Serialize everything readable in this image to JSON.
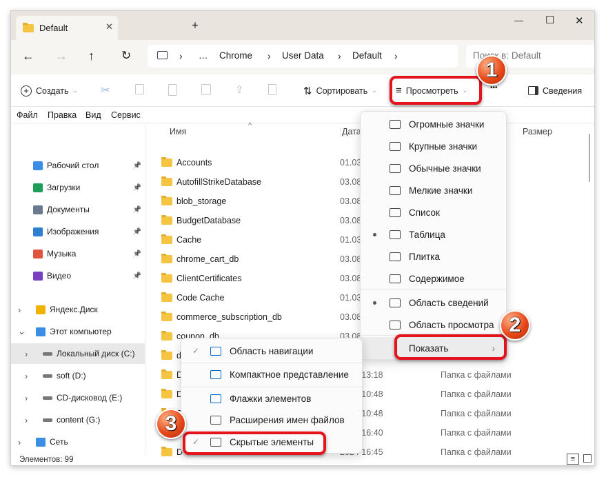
{
  "window": {
    "tab_title": "Default",
    "new_tab": "+",
    "controls": {
      "minimize": "—",
      "maximize": "☐",
      "close": "✕"
    }
  },
  "nav": {
    "breadcrumb": [
      "…",
      "Chrome",
      "User Data",
      "Default"
    ],
    "search_placeholder": "Поиск в: Default"
  },
  "toolbar": {
    "create": "Создать",
    "sort": "Сортировать",
    "view": "Просмотреть",
    "more": "•••",
    "details": "Сведения"
  },
  "menubar": [
    "Файл",
    "Правка",
    "Вид",
    "Сервис"
  ],
  "sidebar": {
    "quick": [
      {
        "label": "Рабочий стол",
        "color": "#3a8ee6"
      },
      {
        "label": "Загрузки",
        "color": "#1f9e5a"
      },
      {
        "label": "Документы",
        "color": "#6b7a8f"
      },
      {
        "label": "Изображения",
        "color": "#2f7fd0"
      },
      {
        "label": "Музыка",
        "color": "#e0533d"
      },
      {
        "label": "Видео",
        "color": "#7a3fc0"
      }
    ],
    "tree": [
      {
        "label": "Яндекс.Диск",
        "color": "#f0b400"
      },
      {
        "label": "Этот компьютер",
        "color": "#3a8ee6"
      },
      {
        "label": "Локальный диск (C:)",
        "color": "#777"
      },
      {
        "label": "soft (D:)",
        "color": "#777"
      },
      {
        "label": "CD-дисковод (E:)",
        "color": "#777"
      },
      {
        "label": "content (G:)",
        "color": "#777"
      },
      {
        "label": "Сеть",
        "color": "#3a8ee6"
      }
    ]
  },
  "columns": {
    "name": "Имя",
    "date": "Дата и",
    "size": "Размер"
  },
  "files": [
    {
      "name": "Accounts",
      "date": "01.03."
    },
    {
      "name": "AutofillStrikeDatabase",
      "date": "03.08."
    },
    {
      "name": "blob_storage",
      "date": "03.08."
    },
    {
      "name": "BudgetDatabase",
      "date": "03.08."
    },
    {
      "name": "Cache",
      "date": "01.03."
    },
    {
      "name": "chrome_cart_db",
      "date": "03.08."
    },
    {
      "name": "ClientCertificates",
      "date": "03.08."
    },
    {
      "name": "Code Cache",
      "date": "01.03."
    },
    {
      "name": "commerce_subscription_db",
      "date": "03.08."
    },
    {
      "name": "coupon_db",
      "date": "03.08."
    },
    {
      "name": "da",
      "date": ""
    },
    {
      "name": "D",
      "date": "2024 13:18",
      "type": "Папка с файлами"
    },
    {
      "name": "D",
      "date": "2024 10:48",
      "type": "Папка с файлами"
    },
    {
      "name": "D",
      "date": "2024 10:48",
      "type": "Папка с файлами"
    },
    {
      "name": "D",
      "date": "2024 16:40",
      "type": "Папка с файлами"
    },
    {
      "name": "D",
      "date": "2024 16:45",
      "type": "Папка с файлами"
    }
  ],
  "status": "Элементов: 99",
  "view_menu": [
    {
      "label": "Огромные значки"
    },
    {
      "label": "Крупные значки"
    },
    {
      "label": "Обычные значки"
    },
    {
      "label": "Мелкие значки"
    },
    {
      "label": "Список"
    },
    {
      "label": "Таблица",
      "selected": true
    },
    {
      "label": "Плитка"
    },
    {
      "label": "Содержимое"
    },
    {
      "label": "Область сведений",
      "selected": true
    },
    {
      "label": "Область просмотра"
    },
    {
      "label": "Показать",
      "submenu": true
    }
  ],
  "show_menu": [
    {
      "label": "Область навигации",
      "checked": true
    },
    {
      "label": "Компактное представление"
    },
    {
      "label": "Флажки элементов"
    },
    {
      "label": "Расширения имен файлов"
    },
    {
      "label": "Скрытые элементы",
      "checked": true
    }
  ],
  "badges": [
    "1",
    "2",
    "3"
  ],
  "colors": {
    "highlight": "#e3141b",
    "folder": "#f5c443",
    "accent": "#0067c0"
  }
}
